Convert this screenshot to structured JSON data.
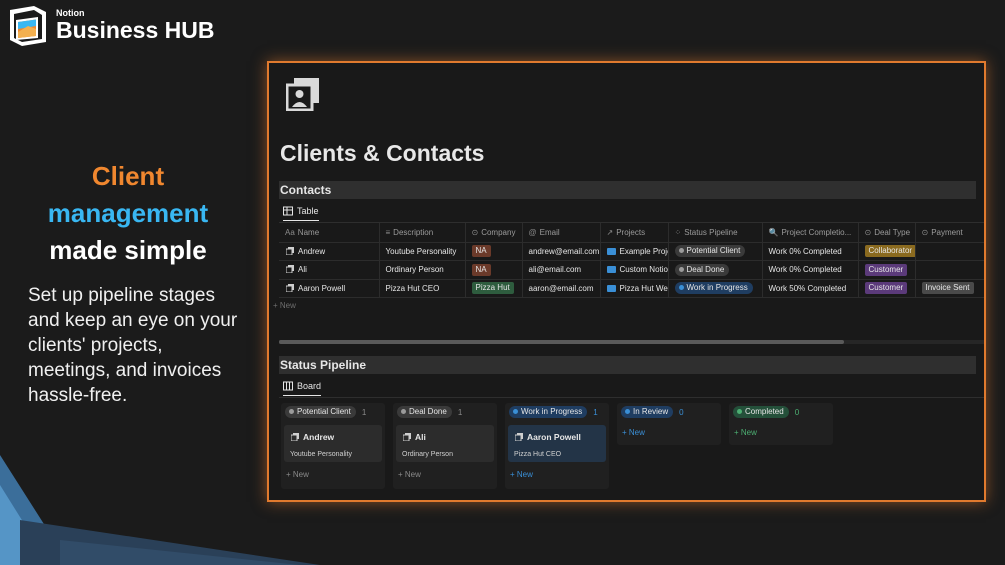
{
  "brand": {
    "small": "Notion",
    "big": "Business HUB"
  },
  "headline": {
    "line1": "Client",
    "line2": "management",
    "line3": "made simple"
  },
  "subtext": "Set up pipeline stages and keep an eye on your clients' projects, meetings, and invoices hassle-free.",
  "colors": {
    "accent_orange": "#f0872f",
    "accent_blue": "#39b7f2",
    "frame_glow": "#e07a2e"
  },
  "page": {
    "icon": "contact-card-icon",
    "title": "Clients & Contacts"
  },
  "contacts": {
    "section_title": "Contacts",
    "view_label": "Table",
    "columns": [
      "Name",
      "Description",
      "Company",
      "Email",
      "Projects",
      "Status Pipeline",
      "Project Completio...",
      "Deal Type",
      "Payment"
    ],
    "column_icons": [
      "Aa",
      "≡",
      "⊙",
      "@",
      "↗",
      "⁘",
      "🔍",
      "⊙",
      "⊙"
    ],
    "rows": [
      {
        "name": "Andrew",
        "description": "Youtube Personality",
        "company": "NA",
        "email": "andrew@email.com",
        "project": "Example Proje",
        "status": "Potential Client",
        "completion": "Work 0% Completed",
        "deal": "Collaborator",
        "payment": ""
      },
      {
        "name": "Ali",
        "description": "Ordinary Person",
        "company": "NA",
        "email": "ali@email.com",
        "project": "Custom Notio",
        "status": "Deal Done",
        "completion": "Work 0% Completed",
        "deal": "Customer",
        "payment": ""
      },
      {
        "name": "Aaron Powell",
        "description": "Pizza Hut CEO",
        "company": "Pizza Hut",
        "email": "aaron@email.com",
        "project": "Pizza Hut Wel",
        "status": "Work in Progress",
        "completion": "Work 50% Completed",
        "deal": "Customer",
        "payment": "Invoice Sent"
      }
    ],
    "new_label": "+ New"
  },
  "pipeline": {
    "section_title": "Status Pipeline",
    "view_label": "Board",
    "groups": [
      {
        "label": "Potential Client",
        "count": "1",
        "card_title": "Andrew",
        "card_sub": "Youtube Personality",
        "new_label": "+ New"
      },
      {
        "label": "Deal Done",
        "count": "1",
        "card_title": "Ali",
        "card_sub": "Ordinary Person",
        "new_label": "+ New"
      },
      {
        "label": "Work in Progress",
        "count": "1",
        "card_title": "Aaron Powell",
        "card_sub": "Pizza Hut CEO",
        "new_label": "+ New"
      },
      {
        "label": "In Review",
        "count": "0",
        "new_label": "+ New"
      },
      {
        "label": "Completed",
        "count": "0",
        "new_label": "+ New"
      }
    ]
  }
}
